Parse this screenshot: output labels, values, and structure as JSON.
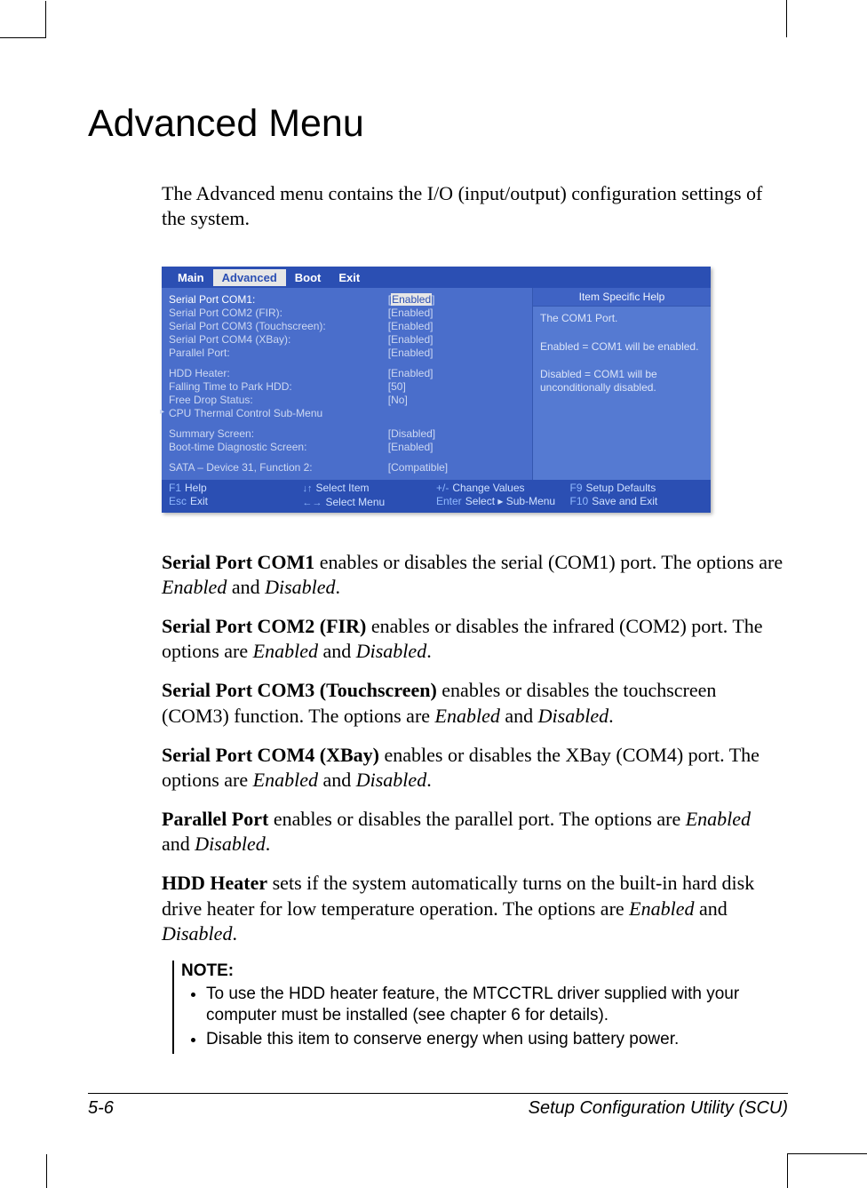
{
  "title": "Advanced Menu",
  "intro": "The Advanced menu contains the I/O (input/output) configuration settings of the system.",
  "bios": {
    "tabs": [
      "Main",
      "Advanced",
      "Boot",
      "Exit"
    ],
    "active_tab": "Advanced",
    "rows": [
      {
        "label": "Serial Port COM1:",
        "value": "[Enabled]",
        "highlight": true
      },
      {
        "label": "Serial Port COM2 (FIR):",
        "value": "[Enabled]"
      },
      {
        "label": "Serial Port COM3 (Touchscreen):",
        "value": "[Enabled]"
      },
      {
        "label": "Serial Port COM4 (XBay):",
        "value": "[Enabled]"
      },
      {
        "label": "Parallel Port:",
        "value": "[Enabled]"
      },
      {
        "spacer": true
      },
      {
        "label": "HDD Heater:",
        "value": "[Enabled]"
      },
      {
        "label": "Falling Time to Park HDD:",
        "value": "[50]"
      },
      {
        "label": "Free Drop Status:",
        "value": "[No]"
      },
      {
        "label": "CPU Thermal Control Sub-Menu",
        "value": "",
        "submenu": true
      },
      {
        "spacer": true
      },
      {
        "label": "Summary Screen:",
        "value": "[Disabled]"
      },
      {
        "label": "Boot-time Diagnostic Screen:",
        "value": "[Enabled]"
      },
      {
        "spacer": true
      },
      {
        "label": "SATA – Device 31, Function 2:",
        "value": "[Compatible]"
      }
    ],
    "help_title": "Item Specific Help",
    "help_body_1": "The COM1 Port.",
    "help_body_2": "Enabled = COM1 will be enabled.",
    "help_body_3": "Disabled = COM1 will be unconditionally disabled.",
    "footer": {
      "f1": "F1",
      "f1l": "Help",
      "esc": "Esc",
      "escl": "Exit",
      "ud": "↓↑",
      "udl": "Select Item",
      "lr": "←→",
      "lrl": "Select Menu",
      "pm": "+/-",
      "pml": "Change Values",
      "ent": "Enter",
      "entl": "Select ▸ Sub-Menu",
      "f9": "F9",
      "f9l": "Setup Defaults",
      "f10": "F10",
      "f10l": "Save and Exit"
    }
  },
  "defs": [
    {
      "term": "Serial Port COM1",
      "text": "  enables or disables the serial (COM1) port. The options are ",
      "opts": "Enabled and Disabled."
    },
    {
      "term": "Serial Port COM2 (FIR)",
      "text": "  enables or disables the infrared (COM2) port. The options are ",
      "opts": "Enabled and Disabled."
    },
    {
      "term": "Serial Port COM3 (Touchscreen)",
      "text": "  enables or disables the touchscreen (COM3) function. The options are ",
      "opts": "Enabled and Disabled."
    },
    {
      "term": "Serial Port COM4 (XBay)",
      "text": "  enables or disables the XBay (COM4) port. The options are ",
      "opts": "Enabled and Disabled."
    },
    {
      "term": "Parallel Port",
      "text": "  enables or disables the parallel port. The options are ",
      "opts": "Enabled and Disabled."
    },
    {
      "term": "HDD Heater",
      "text": "  sets if the system automatically turns on the built-in hard disk drive heater for low temperature operation. The options are ",
      "opts": "Enabled and Disabled."
    }
  ],
  "note": {
    "label": "NOTE:",
    "items": [
      "To use the HDD heater feature, the MTCCTRL driver supplied with your computer must be installed (see chapter 6 for details).",
      "Disable this item to conserve energy when using battery power."
    ]
  },
  "footer": {
    "left": "5-6",
    "right": "Setup Configuration Utility (SCU)"
  }
}
